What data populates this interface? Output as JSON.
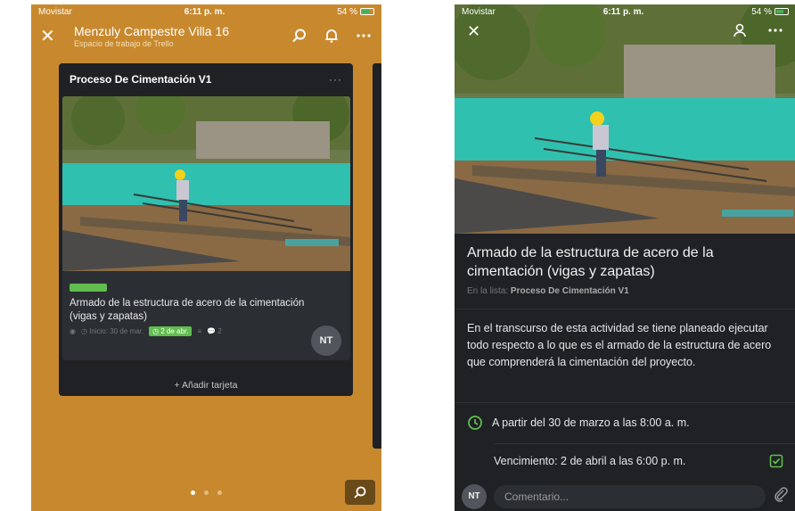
{
  "status_bar": {
    "carrier": "Movistar",
    "time": "6:11 p. m.",
    "battery": "54 %"
  },
  "board": {
    "title": "Menzuly Campestre Villa 16",
    "workspace": "Espacio de trabajo de Trello"
  },
  "list": {
    "title": "Proceso De Cimentación V1",
    "menu": "···",
    "add_card": "+ Añadir tarjeta",
    "card": {
      "title": "Armado de la estructura de acero de la cimentación (vigas y zapatas)",
      "start": "Inicio: 30 de mar.",
      "due": "2 de abr.",
      "comments": "2",
      "member": "NT"
    }
  },
  "detail": {
    "title": "Armado de la estructura de acero de la cimentación (vigas y zapatas)",
    "in_list_label": "En la lista:",
    "in_list_value": "Proceso De Cimentación V1",
    "description": "En el transcurso de esta actividad se tiene planeado ejecutar todo respecto a lo que es el armado de la estructura de acero que comprenderá la cimentación del proyecto.",
    "start_text": "A partir del 30 de marzo a las 8:00 a. m.",
    "due_text": "Vencimiento: 2 de abril a las 6:00 p. m.",
    "member": "NT",
    "comment_placeholder": "Comentario..."
  },
  "colors": {
    "board_bg": "#c8892e",
    "label_green": "#61bd4f",
    "dark_bg": "#1f2124"
  },
  "pager": {
    "pages": 3,
    "active": 1
  }
}
